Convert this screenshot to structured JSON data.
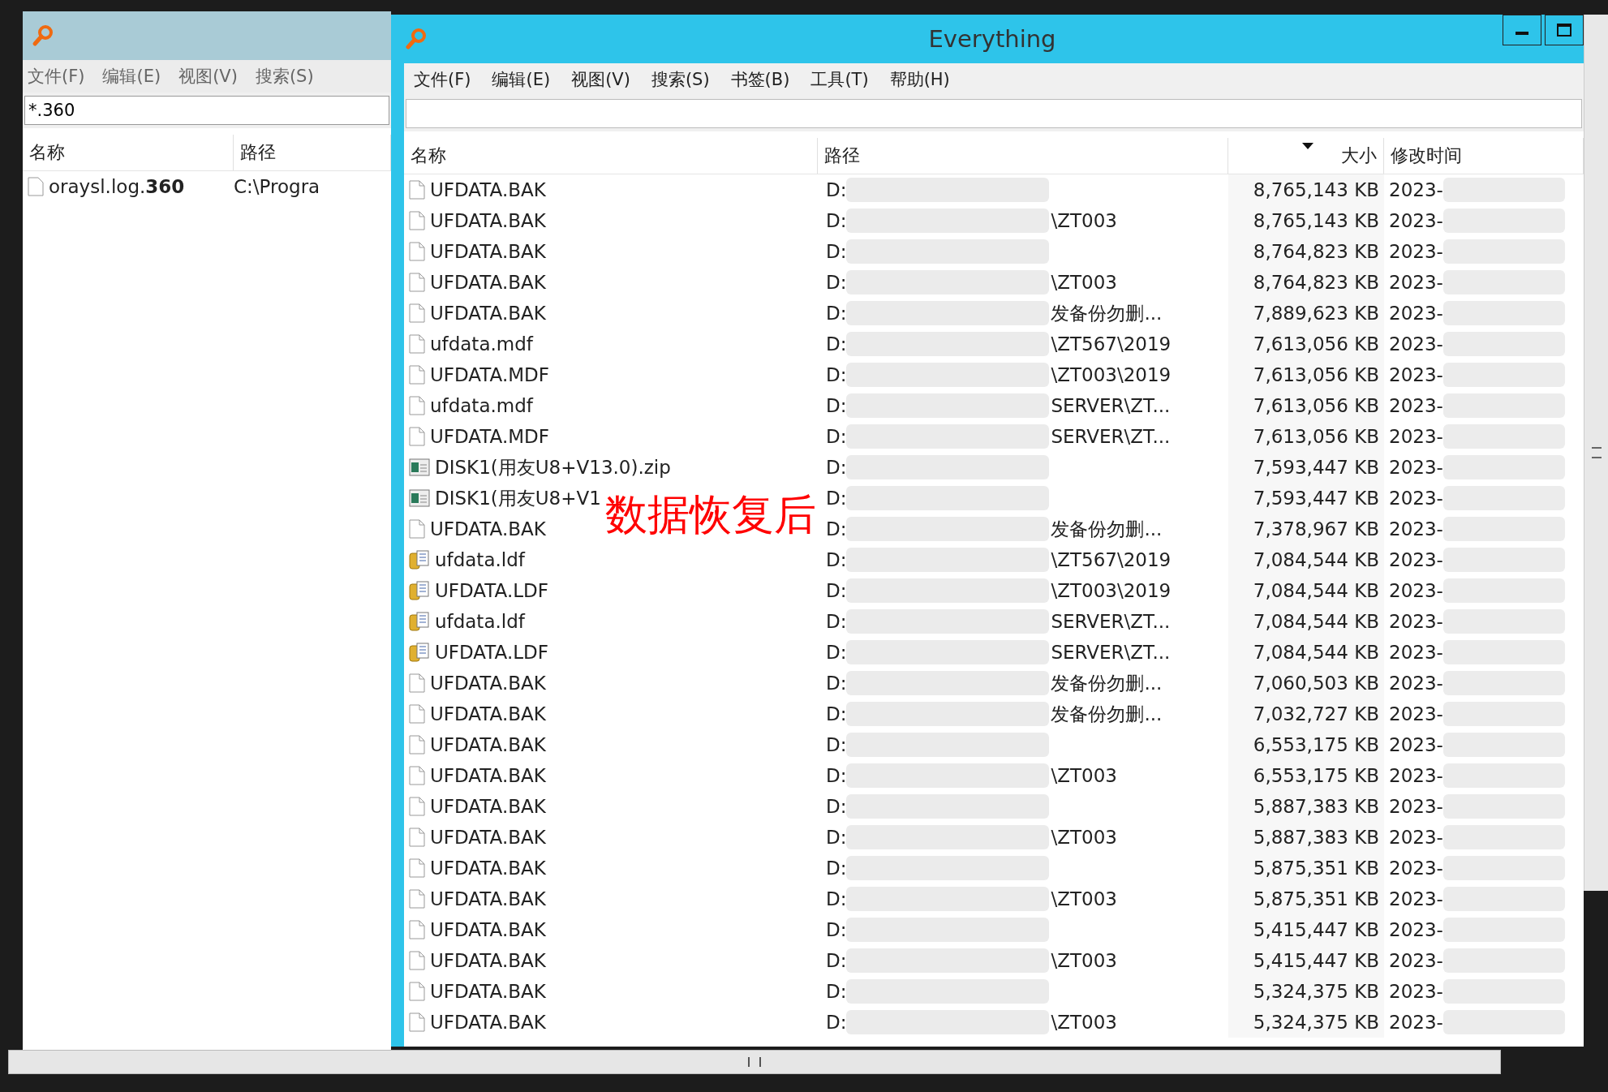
{
  "back_window": {
    "menu": [
      "文件(F)",
      "编辑(E)",
      "视图(V)",
      "搜索(S)"
    ],
    "search": {
      "value": "*.360"
    },
    "table": {
      "columns": [
        "名称",
        "路径"
      ],
      "rows": [
        {
          "name": "oraysl.log.**360**",
          "path": "C:\\Progra"
        }
      ]
    }
  },
  "window": {
    "title": "Everything",
    "menu": [
      "文件(F)",
      "编辑(E)",
      "视图(V)",
      "搜索(S)",
      "书签(B)",
      "工具(T)",
      "帮助(H)"
    ],
    "table": {
      "columns": [
        "名称",
        "路径",
        "大小",
        "修改时间"
      ],
      "rows": [
        {
          "kind": "file",
          "name": "UFDATA.BAK",
          "path_prefix": "D:",
          "path_suffix": "",
          "size": "8,765,143 KB",
          "date": "2023-"
        },
        {
          "kind": "file",
          "name": "UFDATA.BAK",
          "path_prefix": "D:",
          "path_suffix": "\\ZT003",
          "size": "8,765,143 KB",
          "date": "2023-"
        },
        {
          "kind": "file",
          "name": "UFDATA.BAK",
          "path_prefix": "D:",
          "path_suffix": "",
          "size": "8,764,823 KB",
          "date": "2023-"
        },
        {
          "kind": "file",
          "name": "UFDATA.BAK",
          "path_prefix": "D:",
          "path_suffix": "\\ZT003",
          "size": "8,764,823 KB",
          "date": "2023-"
        },
        {
          "kind": "file",
          "name": "UFDATA.BAK",
          "path_prefix": "D:",
          "path_suffix": "发备份勿删...",
          "size": "7,889,623 KB",
          "date": "2023-"
        },
        {
          "kind": "file",
          "name": "ufdata.mdf",
          "path_prefix": "D:",
          "path_suffix": "\\ZT567\\2019",
          "size": "7,613,056 KB",
          "date": "2023-"
        },
        {
          "kind": "file",
          "name": "UFDATA.MDF",
          "path_prefix": "D:",
          "path_suffix": "\\ZT003\\2019",
          "size": "7,613,056 KB",
          "date": "2023-"
        },
        {
          "kind": "file",
          "name": "ufdata.mdf",
          "path_prefix": "D:",
          "path_suffix": "SERVER\\ZT...",
          "size": "7,613,056 KB",
          "date": "2023-"
        },
        {
          "kind": "file",
          "name": "UFDATA.MDF",
          "path_prefix": "D:",
          "path_suffix": "SERVER\\ZT...",
          "size": "7,613,056 KB",
          "date": "2023-"
        },
        {
          "kind": "zip",
          "name": "DISK1(用友U8+V13.0).zip",
          "path_prefix": "D:",
          "path_suffix": "",
          "size": "7,593,447 KB",
          "date": "2023-"
        },
        {
          "kind": "zip",
          "name": "DISK1(用友U8+V1",
          "path_prefix": "D:",
          "path_suffix": "",
          "size": "7,593,447 KB",
          "date": "2023-"
        },
        {
          "kind": "file",
          "name": "UFDATA.BAK",
          "path_prefix": "D:",
          "path_suffix": "发备份勿删...",
          "size": "7,378,967 KB",
          "date": "2023-"
        },
        {
          "kind": "ldf",
          "name": "ufdata.ldf",
          "path_prefix": "D:",
          "path_suffix": "\\ZT567\\2019",
          "size": "7,084,544 KB",
          "date": "2023-"
        },
        {
          "kind": "ldf",
          "name": "UFDATA.LDF",
          "path_prefix": "D:",
          "path_suffix": "\\ZT003\\2019",
          "size": "7,084,544 KB",
          "date": "2023-"
        },
        {
          "kind": "ldf",
          "name": "ufdata.ldf",
          "path_prefix": "D:",
          "path_suffix": "SERVER\\ZT...",
          "size": "7,084,544 KB",
          "date": "2023-"
        },
        {
          "kind": "ldf",
          "name": "UFDATA.LDF",
          "path_prefix": "D:",
          "path_suffix": "SERVER\\ZT...",
          "size": "7,084,544 KB",
          "date": "2023-"
        },
        {
          "kind": "file",
          "name": "UFDATA.BAK",
          "path_prefix": "D:",
          "path_suffix": "发备份勿删...",
          "size": "7,060,503 KB",
          "date": "2023-"
        },
        {
          "kind": "file",
          "name": "UFDATA.BAK",
          "path_prefix": "D:",
          "path_suffix": "发备份勿删...",
          "size": "7,032,727 KB",
          "date": "2023-"
        },
        {
          "kind": "file",
          "name": "UFDATA.BAK",
          "path_prefix": "D:",
          "path_suffix": "",
          "size": "6,553,175 KB",
          "date": "2023-"
        },
        {
          "kind": "file",
          "name": "UFDATA.BAK",
          "path_prefix": "D:",
          "path_suffix": "\\ZT003",
          "size": "6,553,175 KB",
          "date": "2023-"
        },
        {
          "kind": "file",
          "name": "UFDATA.BAK",
          "path_prefix": "D:",
          "path_suffix": "",
          "size": "5,887,383 KB",
          "date": "2023-"
        },
        {
          "kind": "file",
          "name": "UFDATA.BAK",
          "path_prefix": "D:",
          "path_suffix": "\\ZT003",
          "size": "5,887,383 KB",
          "date": "2023-"
        },
        {
          "kind": "file",
          "name": "UFDATA.BAK",
          "path_prefix": "D:",
          "path_suffix": "",
          "size": "5,875,351 KB",
          "date": "2023-"
        },
        {
          "kind": "file",
          "name": "UFDATA.BAK",
          "path_prefix": "D:",
          "path_suffix": "\\ZT003",
          "size": "5,875,351 KB",
          "date": "2023-"
        },
        {
          "kind": "file",
          "name": "UFDATA.BAK",
          "path_prefix": "D:",
          "path_suffix": "",
          "size": "5,415,447 KB",
          "date": "2023-"
        },
        {
          "kind": "file",
          "name": "UFDATA.BAK",
          "path_prefix": "D:",
          "path_suffix": "\\ZT003",
          "size": "5,415,447 KB",
          "date": "2023-"
        },
        {
          "kind": "file",
          "name": "UFDATA.BAK",
          "path_prefix": "D:",
          "path_suffix": "",
          "size": "5,324,375 KB",
          "date": "2023-"
        },
        {
          "kind": "file",
          "name": "UFDATA.BAK",
          "path_prefix": "D:",
          "path_suffix": "\\ZT003",
          "size": "5,324,375 KB",
          "date": "2023-"
        }
      ]
    }
  },
  "caption": "数据恢复后"
}
